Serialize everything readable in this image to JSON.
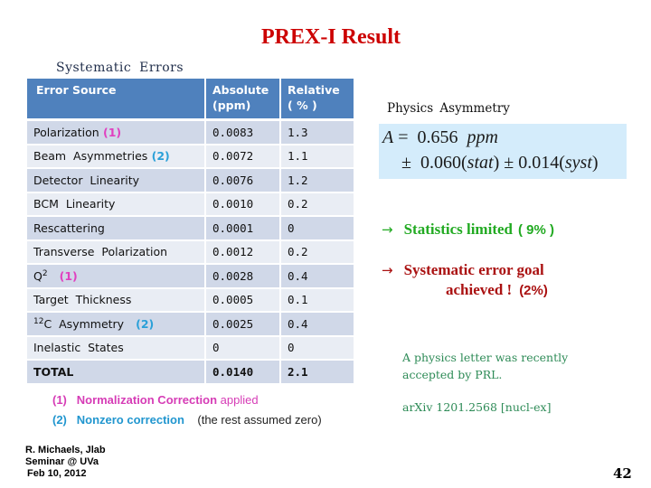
{
  "slide": {
    "title": "PREX-I   Result",
    "page_number": "42"
  },
  "systematics": {
    "heading": "Systematic   Errors",
    "columns": [
      "Error   Source",
      "Absolute (ppm)",
      "Relative ( % )"
    ],
    "rows": [
      {
        "source": "Polarization",
        "tag": "(1)",
        "tag_color": "#e040c0",
        "absolute": "0.0083",
        "relative": "1.3"
      },
      {
        "source": "Beam  Asymmetries",
        "tag": "(2)",
        "tag_color": "#2aa0d8",
        "absolute": "0.0072",
        "relative": "1.1"
      },
      {
        "source": "Detector  Linearity",
        "tag": "",
        "absolute": "0.0076",
        "relative": "1.2"
      },
      {
        "source": "BCM  Linearity",
        "tag": "",
        "absolute": "0.0010",
        "relative": "0.2"
      },
      {
        "source": "Rescattering",
        "tag": "",
        "absolute": "0.0001",
        "relative": "0"
      },
      {
        "source": "Transverse  Polarization",
        "tag": "",
        "absolute": "0.0012",
        "relative": "0.2"
      },
      {
        "source": "Q",
        "superscript": "2",
        "tag": "(1)",
        "tag_color": "#e040c0",
        "absolute": "0.0028",
        "relative": "0.4"
      },
      {
        "source": "Target  Thickness",
        "tag": "",
        "absolute": "0.0005",
        "relative": "0.1"
      },
      {
        "source_prefix_sup": "12",
        "source": "C  Asymmetry",
        "tag": "(2)",
        "tag_color": "#2aa0d8",
        "absolute": "0.0025",
        "relative": "0.4"
      },
      {
        "source": "Inelastic  States",
        "tag": "",
        "absolute": "0",
        "relative": "0"
      },
      {
        "source": "TOTAL",
        "tag": "",
        "absolute": "0.0140",
        "relative": "2.1"
      }
    ]
  },
  "notes": [
    {
      "tag": "(1)",
      "label": "Normalization  Correction",
      "rest": "  applied",
      "color": "#d63cb6"
    },
    {
      "tag": "(2)",
      "label": "Nonzero correction",
      "rest": "   (the rest assumed zero)",
      "color": "#2196cf"
    }
  ],
  "credit": [
    "R. Michaels,  Jlab",
    "Seminar @ UVa",
    "Feb 10, 2012"
  ],
  "physics": {
    "label": "Physics  Asymmetry",
    "formula": {
      "symbol": "A",
      "equals": " =  ",
      "value": "0.656",
      "unit": "ppm",
      "pm": "±",
      "stat_value": "0.060",
      "stat_label": "stat",
      "syst_value": "0.014",
      "syst_label": "syst"
    },
    "box_color": "#d4ecfb"
  },
  "conclusions": [
    {
      "arrow": "→",
      "text": "Statistics  limited",
      "pct": "( 9% )",
      "color": "#22aa22"
    },
    {
      "arrow": "→",
      "text": "Systematic error goal",
      "text2": "achieved !",
      "pct": "(2%)",
      "color": "#aa1111"
    }
  ],
  "publication": {
    "letter": "A  physics  letter  was recently accepted by PRL.",
    "arxiv": "arXiv 1201.2568 [nucl-ex]"
  }
}
